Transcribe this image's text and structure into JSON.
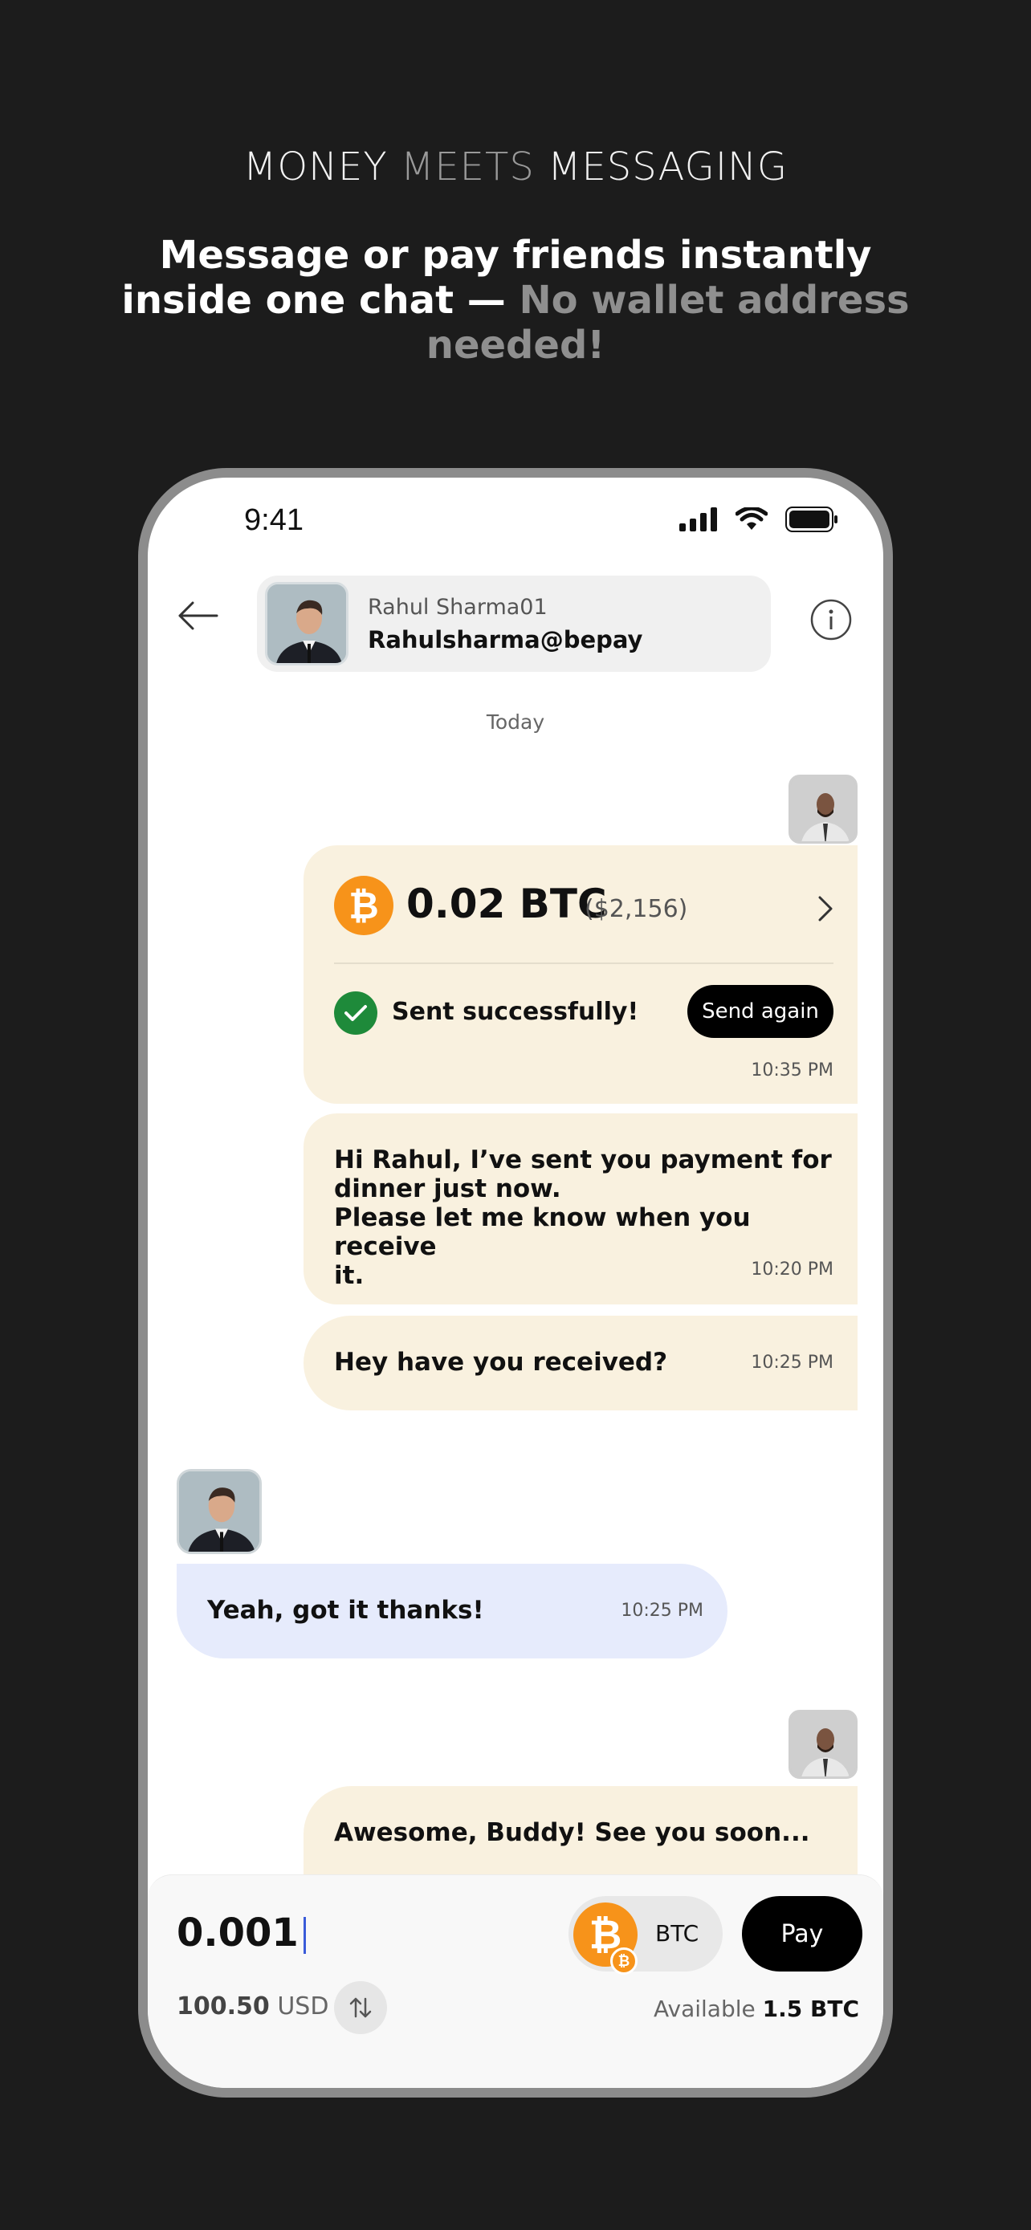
{
  "hero": {
    "tagline_a": "MONEY",
    "tagline_b": "MEETS",
    "tagline_c": "MESSAGING",
    "headline_main": "Message or pay friends instantly inside one chat —",
    "headline_dim": "No wallet address needed!"
  },
  "status_bar": {
    "time": "9:41"
  },
  "contact": {
    "name": "Rahul Sharma01",
    "handle": "Rahulsharma@bepay"
  },
  "chat": {
    "date_separator": "Today",
    "payment": {
      "amount": "0.02 BTC",
      "usd": "($2,156)",
      "status": "Sent successfully!",
      "action": "Send again",
      "time": "10:35 PM"
    },
    "messages": [
      {
        "direction": "out",
        "text_lines": [
          "Hi Rahul, I’ve sent you payment for",
          "dinner just now.",
          "Please let me know when you receive",
          "it."
        ],
        "time": "10:20 PM"
      },
      {
        "direction": "out",
        "text": "Hey have you received?",
        "time": "10:25 PM"
      },
      {
        "direction": "in",
        "text": "Yeah, got it thanks!",
        "time": "10:25 PM"
      },
      {
        "direction": "out",
        "text": "Awesome, Buddy! See you soon..."
      }
    ]
  },
  "composer": {
    "amount": "0.001",
    "usd_value": "100.50",
    "usd_unit": "USD",
    "currency": "BTC",
    "pay_label": "Pay",
    "available_label": "Available",
    "available_value": "1.5 BTC"
  },
  "colors": {
    "background": "#1c1c1c",
    "outgoing_bubble": "#f9f1df",
    "incoming_bubble": "#e6ebfc",
    "bitcoin": "#f7931a",
    "success": "#1e8a3a"
  }
}
